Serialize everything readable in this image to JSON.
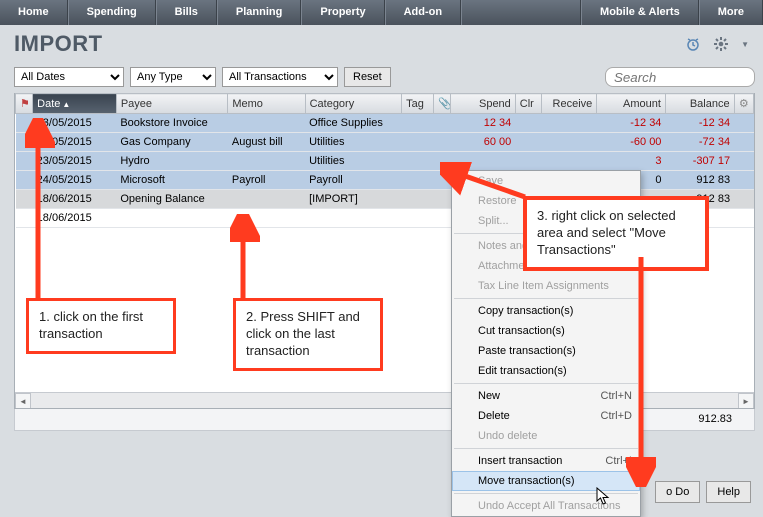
{
  "nav": {
    "items": [
      "Home",
      "Spending",
      "Bills",
      "Planning",
      "Property",
      "Add-on"
    ],
    "right": [
      "Mobile & Alerts",
      "More"
    ]
  },
  "title": "IMPORT",
  "filters": {
    "dates": "All Dates",
    "type": "Any Type",
    "txns": "All Transactions",
    "reset": "Reset",
    "search_ph": "Search"
  },
  "columns": {
    "flag": "⚑",
    "date": "Date",
    "payee": "Payee",
    "memo": "Memo",
    "category": "Category",
    "tag": "Tag",
    "clip": "📎",
    "spend": "Spend",
    "clr": "Clr",
    "receive": "Receive",
    "amount": "Amount",
    "balance": "Balance"
  },
  "rows": [
    {
      "date": "23/05/2015",
      "payee": "Bookstore Invoice",
      "memo": "",
      "cat": "Office Supplies",
      "spend": "12 34",
      "amt": "-12 34",
      "bal": "-12 34",
      "neg": true,
      "sel": true
    },
    {
      "date": "23/05/2015",
      "payee": "Gas Company",
      "memo": "August bill",
      "cat": "Utilities",
      "spend": "60 00",
      "amt": "-60 00",
      "bal": "-72 34",
      "neg": true,
      "sel": true
    },
    {
      "date": "23/05/2015",
      "payee": "Hydro",
      "memo": "",
      "cat": "Utilities",
      "spend": "",
      "amt": "3",
      "bal": "-307 17",
      "neg": true,
      "sel": true
    },
    {
      "date": "24/05/2015",
      "payee": "Microsoft",
      "memo": "Payroll",
      "cat": "Payroll",
      "spend": "",
      "amt": "0",
      "bal": "912 83",
      "neg": false,
      "sel": true
    },
    {
      "date": "18/06/2015",
      "payee": "Opening Balance",
      "memo": "",
      "cat": "[IMPORT]",
      "spend": "",
      "amt": "",
      "bal": "912 83",
      "neg": false,
      "sel": false,
      "active": true
    },
    {
      "date": "18/06/2015",
      "payee": "",
      "memo": "",
      "cat": "",
      "spend": "",
      "amt": "",
      "bal": "",
      "neg": false,
      "sel": false
    }
  ],
  "balance_total": "912.83",
  "bottom": {
    "todo": "o Do",
    "help": "Help"
  },
  "ctx": {
    "save": "Save",
    "restore": "Restore",
    "split": "Split...",
    "notes": "Notes and ...",
    "attach": "Attachments",
    "tax": "Tax Line Item Assignments",
    "copy": "Copy transaction(s)",
    "cut": "Cut transaction(s)",
    "paste": "Paste transaction(s)",
    "edit": "Edit transaction(s)",
    "new": "New",
    "new_sc": "Ctrl+N",
    "delete": "Delete",
    "delete_sc": "Ctrl+D",
    "undodel": "Undo delete",
    "insert": "Insert transaction",
    "insert_sc": "Ctrl+I",
    "move": "Move transaction(s)",
    "undoaccept": "Undo Accept All Transactions"
  },
  "annot": {
    "a1": "1. click on the first transaction",
    "a2": "2. Press SHIFT and click on the last transaction",
    "a3": "3. right click on selected area and select \"Move Transactions\""
  }
}
